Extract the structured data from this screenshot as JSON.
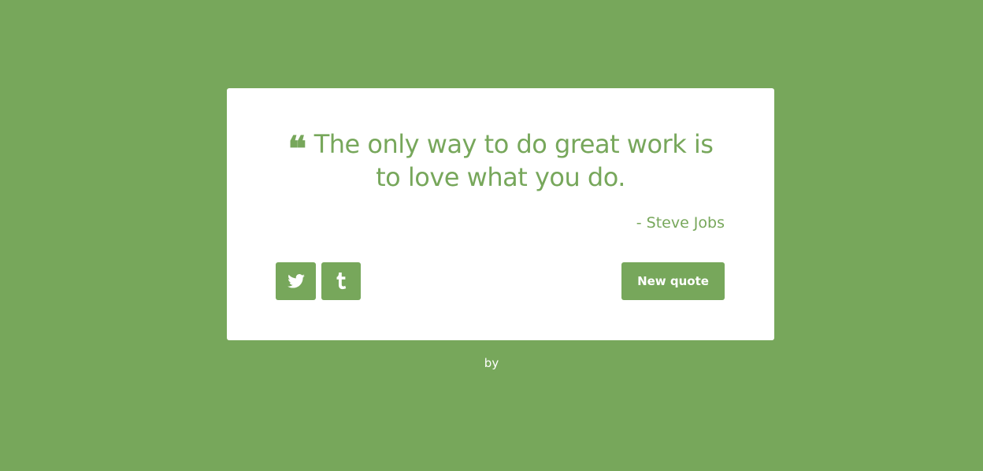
{
  "colors": {
    "background": "#77a75b",
    "card": "#ffffff",
    "accent": "#77a75b",
    "button_text": "#ffffff"
  },
  "quote": {
    "mark_icon": "quote-left-icon",
    "text": "The only way to do great work is to love what you do.",
    "author": "- Steve Jobs"
  },
  "actions": {
    "twitter_icon": "twitter-icon",
    "tumblr_icon": "tumblr-icon",
    "new_quote_label": "New quote"
  },
  "footer": {
    "text": "by"
  }
}
